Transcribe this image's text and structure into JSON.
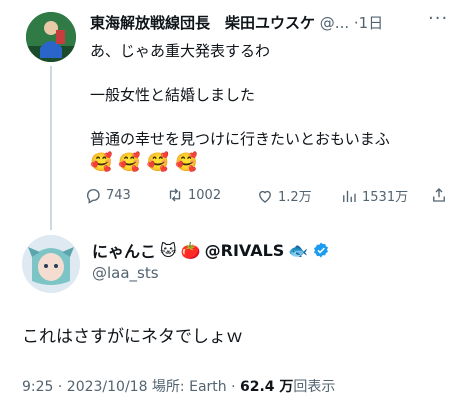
{
  "parent_tweet": {
    "display_name": "東海解放戦線団長　柴田ユウスケ",
    "handle": "@...",
    "time_ago": "1日",
    "more_label": "···",
    "text_lines": [
      "あ、じゃあ重大発表するわ",
      "",
      "一般女性と結婚しました",
      "",
      "普通の幸せを見つけに行きたいとおもいまふ"
    ],
    "emojis": [
      "🥰",
      "🥰",
      "🥰",
      "🥰"
    ],
    "actions": {
      "replies": "743",
      "retweets": "1002",
      "likes": "1.2万",
      "views": "1531万"
    }
  },
  "reply_tweet": {
    "display_name_prefix": "にゃんこ",
    "display_name_emoji_1": "🐱",
    "display_name_emoji_2": "🍅",
    "display_name_suffix": "@RIVALS",
    "display_name_emoji_3": "🐟",
    "handle": "@laa_sts",
    "text": "これはさすがにネタでしょｗ",
    "meta_prefix": "9:25 · 2023/10/18 場所: Earth · ",
    "views_count": "62.4 万",
    "views_suffix": "回表示"
  },
  "colors": {
    "verified": "#1d9bf0",
    "muted": "#536471",
    "thread_line": "#cfd9de"
  },
  "icons": [
    "reply-icon",
    "retweet-icon",
    "like-icon",
    "views-icon",
    "share-icon",
    "verified-icon"
  ]
}
